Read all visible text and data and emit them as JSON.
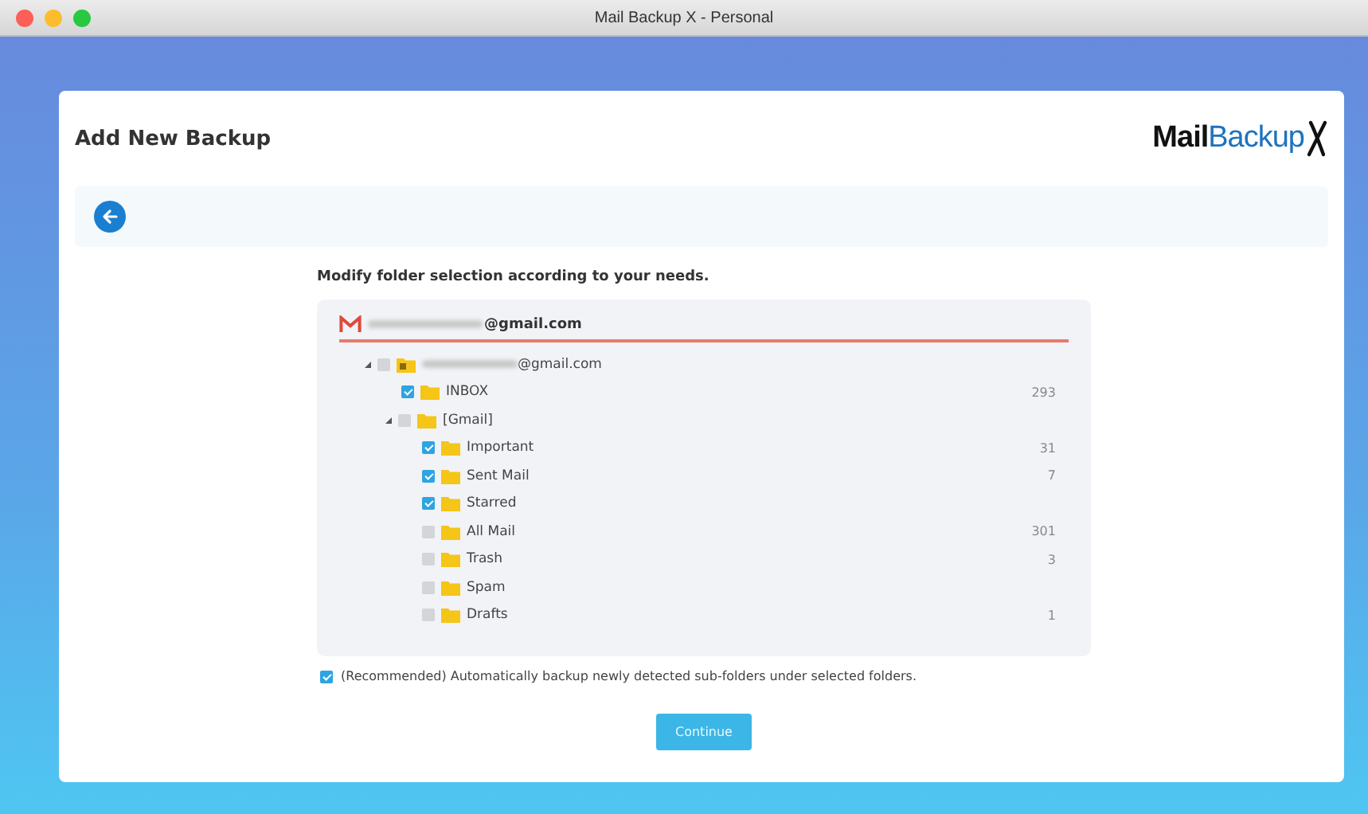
{
  "window": {
    "title": "Mail Backup X - Personal"
  },
  "page_title": "Add New Backup",
  "logo": {
    "first": "Mail",
    "second": "Backup"
  },
  "instruction": "Modify folder selection according to your needs.",
  "account": {
    "email": "@gmail.com"
  },
  "tree": [
    {
      "name": "@gmail.com",
      "kind": "account",
      "checked": false,
      "expanded": true,
      "children": [
        {
          "name": "INBOX",
          "kind": "folder",
          "checked": true,
          "count": "293"
        },
        {
          "name": "[Gmail]",
          "kind": "folder",
          "checked": false,
          "expanded": true,
          "children": [
            {
              "name": "Important",
              "kind": "folder",
              "checked": true,
              "count": "31"
            },
            {
              "name": "Sent Mail",
              "kind": "folder",
              "checked": true,
              "count": "7"
            },
            {
              "name": "Starred",
              "kind": "folder",
              "checked": true
            },
            {
              "name": "All Mail",
              "kind": "folder",
              "checked": false,
              "count": "301"
            },
            {
              "name": "Trash",
              "kind": "folder",
              "checked": false,
              "count": "3"
            },
            {
              "name": "Spam",
              "kind": "folder",
              "checked": false
            },
            {
              "name": "Drafts",
              "kind": "folder",
              "checked": false,
              "count": "1"
            }
          ]
        }
      ]
    }
  ],
  "auto_backup": {
    "label": "(Recommended) Automatically backup newly detected sub-folders under selected folders.",
    "checked": true
  },
  "buttons": [
    "Continue"
  ]
}
